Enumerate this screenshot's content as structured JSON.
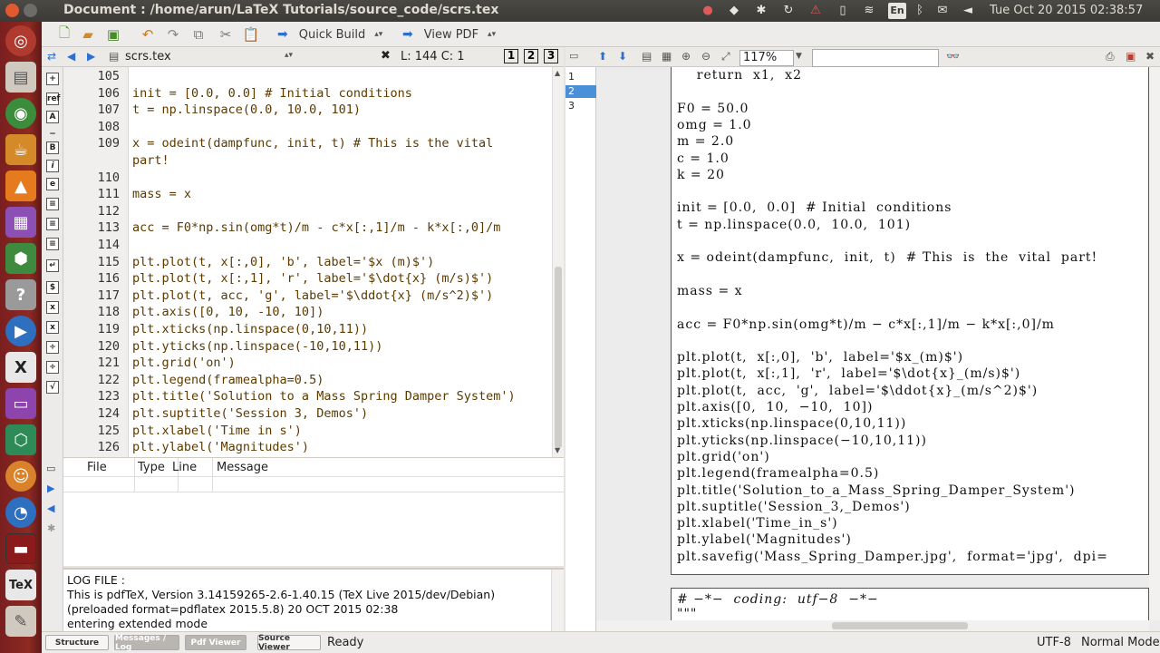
{
  "window": {
    "title": "Document : /home/arun/LaTeX Tutorials/source_code/scrs.tex"
  },
  "tray": {
    "lang": "En",
    "clock": "Tue Oct 20 2015 02:38:57"
  },
  "toolbar": {
    "quick_build": "Quick Build",
    "view_pdf": "View PDF"
  },
  "editor_tab": {
    "filename": "scrs.tex",
    "cursor": "L: 144 C: 1",
    "views": [
      "1",
      "2",
      "3"
    ]
  },
  "side_letters": [
    "ref",
    "A",
    "B",
    "i",
    "e"
  ],
  "editor": {
    "lines": [
      {
        "n": "105",
        "t": ""
      },
      {
        "n": "106",
        "t": "init = [0.0, 0.0] # Initial conditions"
      },
      {
        "n": "107",
        "t": "t = np.linspace(0.0, 10.0, 101)"
      },
      {
        "n": "108",
        "t": ""
      },
      {
        "n": "109",
        "t": "x = odeint(dampfunc, init, t) # This is the vital"
      },
      {
        "n": "",
        "t": "part!"
      },
      {
        "n": "110",
        "t": ""
      },
      {
        "n": "111",
        "t": "mass = x"
      },
      {
        "n": "112",
        "t": ""
      },
      {
        "n": "113",
        "t": "acc = F0*np.sin(omg*t)/m - c*x[:,1]/m - k*x[:,0]/m"
      },
      {
        "n": "114",
        "t": ""
      },
      {
        "n": "115",
        "t": "plt.plot(t, x[:,0], 'b', label='$x (m)$')"
      },
      {
        "n": "116",
        "t": "plt.plot(t, x[:,1], 'r', label='$\\dot{x} (m/s)$')"
      },
      {
        "n": "117",
        "t": "plt.plot(t, acc, 'g', label='$\\ddot{x} (m/s^2)$')"
      },
      {
        "n": "118",
        "t": "plt.axis([0, 10, -10, 10])"
      },
      {
        "n": "119",
        "t": "plt.xticks(np.linspace(0,10,11))"
      },
      {
        "n": "120",
        "t": "plt.yticks(np.linspace(-10,10,11))"
      },
      {
        "n": "121",
        "t": "plt.grid('on')"
      },
      {
        "n": "122",
        "t": "plt.legend(framealpha=0.5)"
      },
      {
        "n": "123",
        "t": "plt.title('Solution to a Mass Spring Damper System')"
      },
      {
        "n": "124",
        "t": "plt.suptitle('Session 3, Demos')"
      },
      {
        "n": "125",
        "t": "plt.xlabel('Time in s')"
      },
      {
        "n": "126",
        "t": "plt.ylabel('Magnitudes')"
      }
    ]
  },
  "messages": {
    "headers": [
      "File",
      "Type",
      "Line",
      "Message"
    ]
  },
  "log": {
    "lines": [
      "LOG FILE :",
      "This is pdfTeX, Version 3.14159265-2.6-1.40.15 (TeX Live 2015/dev/Debian)",
      "(preloaded format=pdflatex 2015.5.8) 20 OCT 2015 02:38",
      "entering extended mode"
    ]
  },
  "statusbar": {
    "tabs": [
      "Structure",
      "Messages / Log",
      "Pdf Viewer",
      "Source Viewer"
    ],
    "ready": "Ready",
    "encoding": "UTF-8",
    "mode": "Normal Mode"
  },
  "pdf": {
    "zoom": "117%",
    "structure": [
      "1",
      "2",
      "3"
    ],
    "lines": [
      "    return  x1,  x2",
      "",
      "F0 = 50.0",
      "omg = 1.0",
      "m = 2.0",
      "c = 1.0",
      "k = 20",
      "",
      "init = [0.0,  0.0]  # Initial  conditions",
      "t = np.linspace(0.0,  10.0,  101)",
      "",
      "x = odeint(dampfunc,  init,  t)  # This  is  the  vital  part!",
      "",
      "mass = x",
      "",
      "acc = F0*np.sin(omg*t)/m − c*x[:,1]/m − k*x[:,0]/m",
      "",
      "plt.plot(t,  x[:,0],  'b',  label='$x_(m)$')",
      "plt.plot(t,  x[:,1],  'r',  label='$\\dot{x}_(m/s)$')",
      "plt.plot(t,  acc,  'g',  label='$\\ddot{x}_(m/s^2)$')",
      "plt.axis([0,  10,  −10,  10])",
      "plt.xticks(np.linspace(0,10,11))",
      "plt.yticks(np.linspace(−10,10,11))",
      "plt.grid('on')",
      "plt.legend(framealpha=0.5)",
      "plt.title('Solution_to_a_Mass_Spring_Damper_System')",
      "plt.suptitle('Session_3,_Demos')",
      "plt.xlabel('Time_in_s')",
      "plt.ylabel('Magnitudes')",
      "plt.savefig('Mass_Spring_Damper.jpg',  format='jpg',  dpi="
    ],
    "page2_lines": [
      "# −*−  coding:  utf−8  −*−",
      "\"\"\""
    ]
  }
}
